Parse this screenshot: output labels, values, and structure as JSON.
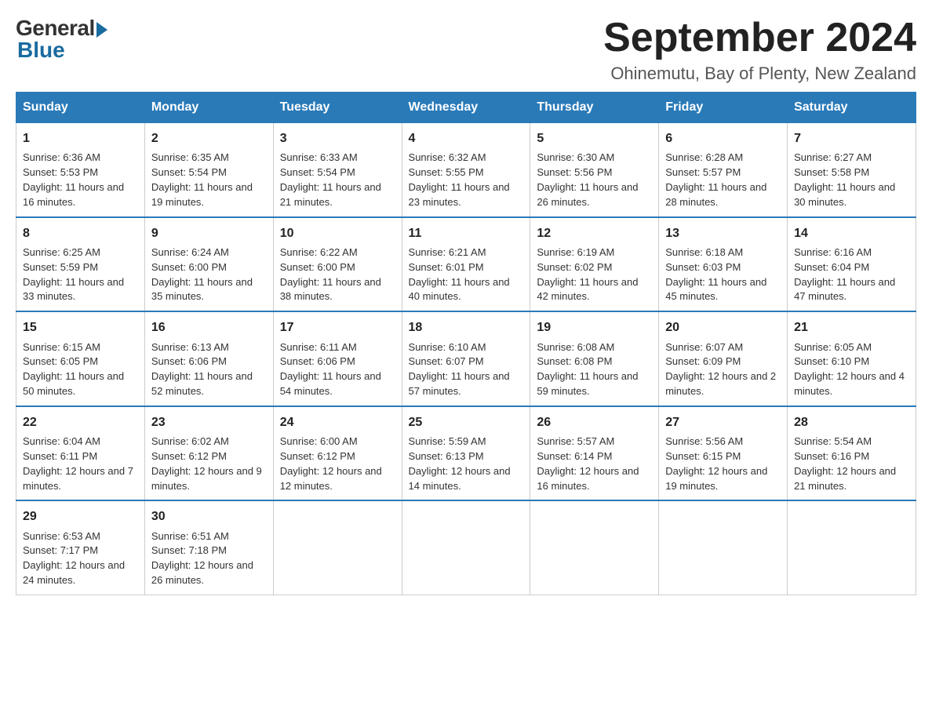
{
  "header": {
    "logo_general": "General",
    "logo_blue": "Blue",
    "title": "September 2024",
    "location": "Ohinemutu, Bay of Plenty, New Zealand"
  },
  "days_of_week": [
    "Sunday",
    "Monday",
    "Tuesday",
    "Wednesday",
    "Thursday",
    "Friday",
    "Saturday"
  ],
  "weeks": [
    [
      {
        "day": 1,
        "sunrise": "6:36 AM",
        "sunset": "5:53 PM",
        "daylight": "11 hours and 16 minutes."
      },
      {
        "day": 2,
        "sunrise": "6:35 AM",
        "sunset": "5:54 PM",
        "daylight": "11 hours and 19 minutes."
      },
      {
        "day": 3,
        "sunrise": "6:33 AM",
        "sunset": "5:54 PM",
        "daylight": "11 hours and 21 minutes."
      },
      {
        "day": 4,
        "sunrise": "6:32 AM",
        "sunset": "5:55 PM",
        "daylight": "11 hours and 23 minutes."
      },
      {
        "day": 5,
        "sunrise": "6:30 AM",
        "sunset": "5:56 PM",
        "daylight": "11 hours and 26 minutes."
      },
      {
        "day": 6,
        "sunrise": "6:28 AM",
        "sunset": "5:57 PM",
        "daylight": "11 hours and 28 minutes."
      },
      {
        "day": 7,
        "sunrise": "6:27 AM",
        "sunset": "5:58 PM",
        "daylight": "11 hours and 30 minutes."
      }
    ],
    [
      {
        "day": 8,
        "sunrise": "6:25 AM",
        "sunset": "5:59 PM",
        "daylight": "11 hours and 33 minutes."
      },
      {
        "day": 9,
        "sunrise": "6:24 AM",
        "sunset": "6:00 PM",
        "daylight": "11 hours and 35 minutes."
      },
      {
        "day": 10,
        "sunrise": "6:22 AM",
        "sunset": "6:00 PM",
        "daylight": "11 hours and 38 minutes."
      },
      {
        "day": 11,
        "sunrise": "6:21 AM",
        "sunset": "6:01 PM",
        "daylight": "11 hours and 40 minutes."
      },
      {
        "day": 12,
        "sunrise": "6:19 AM",
        "sunset": "6:02 PM",
        "daylight": "11 hours and 42 minutes."
      },
      {
        "day": 13,
        "sunrise": "6:18 AM",
        "sunset": "6:03 PM",
        "daylight": "11 hours and 45 minutes."
      },
      {
        "day": 14,
        "sunrise": "6:16 AM",
        "sunset": "6:04 PM",
        "daylight": "11 hours and 47 minutes."
      }
    ],
    [
      {
        "day": 15,
        "sunrise": "6:15 AM",
        "sunset": "6:05 PM",
        "daylight": "11 hours and 50 minutes."
      },
      {
        "day": 16,
        "sunrise": "6:13 AM",
        "sunset": "6:06 PM",
        "daylight": "11 hours and 52 minutes."
      },
      {
        "day": 17,
        "sunrise": "6:11 AM",
        "sunset": "6:06 PM",
        "daylight": "11 hours and 54 minutes."
      },
      {
        "day": 18,
        "sunrise": "6:10 AM",
        "sunset": "6:07 PM",
        "daylight": "11 hours and 57 minutes."
      },
      {
        "day": 19,
        "sunrise": "6:08 AM",
        "sunset": "6:08 PM",
        "daylight": "11 hours and 59 minutes."
      },
      {
        "day": 20,
        "sunrise": "6:07 AM",
        "sunset": "6:09 PM",
        "daylight": "12 hours and 2 minutes."
      },
      {
        "day": 21,
        "sunrise": "6:05 AM",
        "sunset": "6:10 PM",
        "daylight": "12 hours and 4 minutes."
      }
    ],
    [
      {
        "day": 22,
        "sunrise": "6:04 AM",
        "sunset": "6:11 PM",
        "daylight": "12 hours and 7 minutes."
      },
      {
        "day": 23,
        "sunrise": "6:02 AM",
        "sunset": "6:12 PM",
        "daylight": "12 hours and 9 minutes."
      },
      {
        "day": 24,
        "sunrise": "6:00 AM",
        "sunset": "6:12 PM",
        "daylight": "12 hours and 12 minutes."
      },
      {
        "day": 25,
        "sunrise": "5:59 AM",
        "sunset": "6:13 PM",
        "daylight": "12 hours and 14 minutes."
      },
      {
        "day": 26,
        "sunrise": "5:57 AM",
        "sunset": "6:14 PM",
        "daylight": "12 hours and 16 minutes."
      },
      {
        "day": 27,
        "sunrise": "5:56 AM",
        "sunset": "6:15 PM",
        "daylight": "12 hours and 19 minutes."
      },
      {
        "day": 28,
        "sunrise": "5:54 AM",
        "sunset": "6:16 PM",
        "daylight": "12 hours and 21 minutes."
      }
    ],
    [
      {
        "day": 29,
        "sunrise": "6:53 AM",
        "sunset": "7:17 PM",
        "daylight": "12 hours and 24 minutes."
      },
      {
        "day": 30,
        "sunrise": "6:51 AM",
        "sunset": "7:18 PM",
        "daylight": "12 hours and 26 minutes."
      },
      null,
      null,
      null,
      null,
      null
    ]
  ],
  "labels": {
    "sunrise": "Sunrise:",
    "sunset": "Sunset:",
    "daylight": "Daylight:"
  }
}
